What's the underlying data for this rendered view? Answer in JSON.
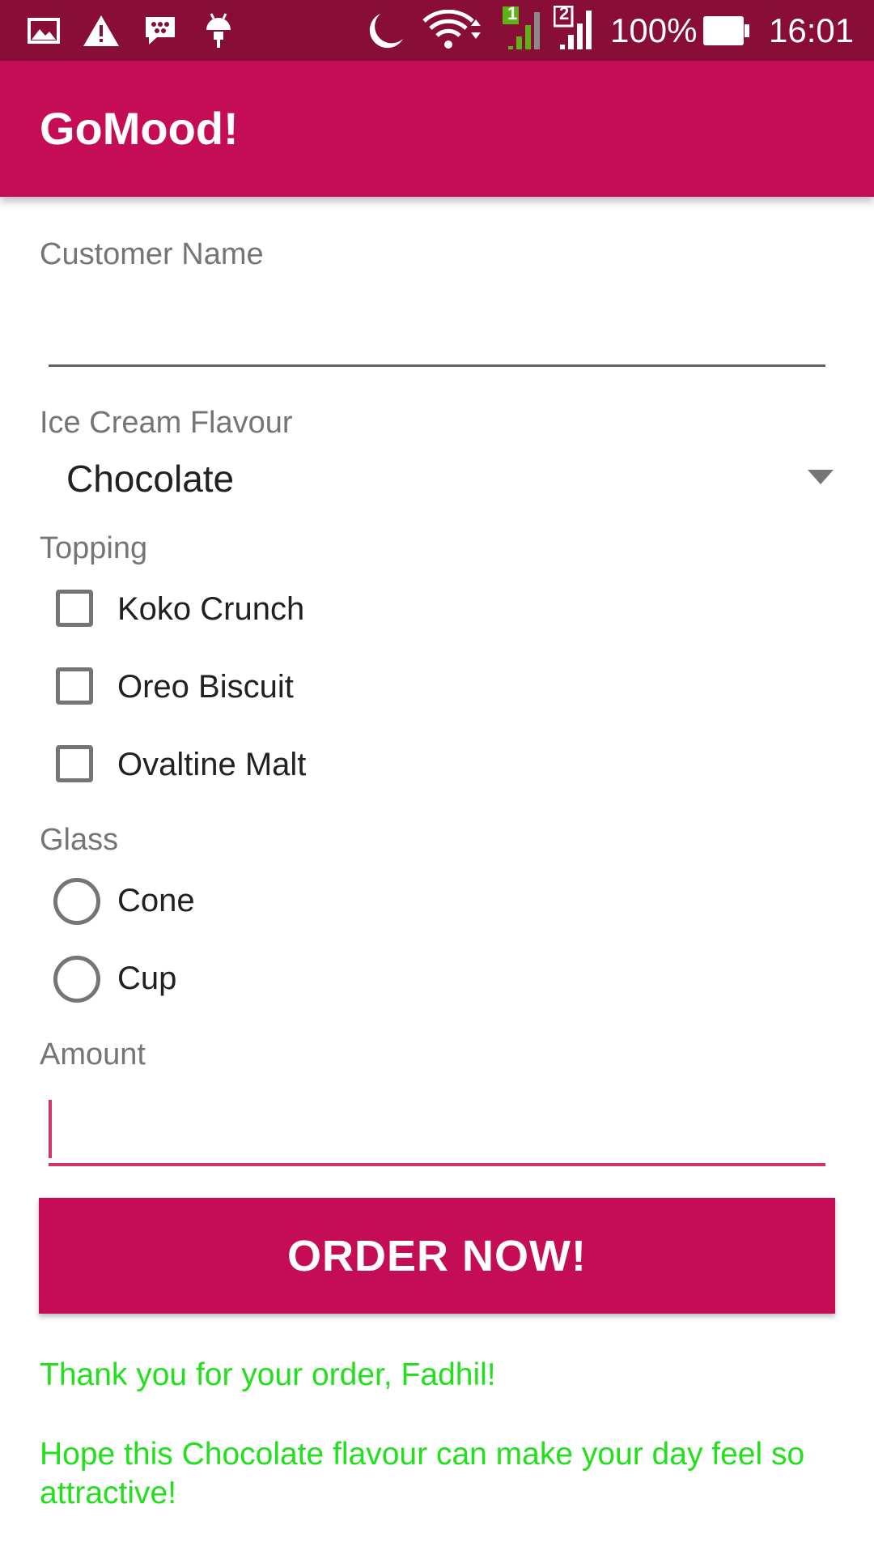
{
  "status_bar": {
    "icons": [
      "gallery-icon",
      "warning-icon",
      "bbm-icon",
      "android-icon",
      "moon-icon",
      "wifi-icon",
      "sim1-signal-icon",
      "sim2-signal-icon",
      "battery-icon"
    ],
    "sim1_label": "1",
    "sim2_label": "2",
    "battery": "100%",
    "time": "16:01"
  },
  "app_bar": {
    "title": "GoMood!"
  },
  "form": {
    "customer_name": {
      "label": "Customer Name",
      "value": ""
    },
    "flavour": {
      "label": "Ice Cream Flavour",
      "selected": "Chocolate"
    },
    "topping": {
      "label": "Topping",
      "options": [
        {
          "label": "Koko Crunch",
          "checked": false
        },
        {
          "label": "Oreo Biscuit",
          "checked": false
        },
        {
          "label": "Ovaltine Malt",
          "checked": false
        }
      ]
    },
    "glass": {
      "label": "Glass",
      "options": [
        {
          "label": "Cone",
          "selected": false
        },
        {
          "label": "Cup",
          "selected": false
        }
      ]
    },
    "amount": {
      "label": "Amount",
      "value": ""
    },
    "order_button": "ORDER NOW!"
  },
  "messages": {
    "thank_you": "Thank you for your order, Fadhil!",
    "hope": "Hope this Chocolate flavour can make your day feel so attractive!"
  },
  "colors": {
    "status_bar": "#880E37",
    "primary": "#C40D55",
    "accent": "#D6336C",
    "message": "#22E01B"
  }
}
